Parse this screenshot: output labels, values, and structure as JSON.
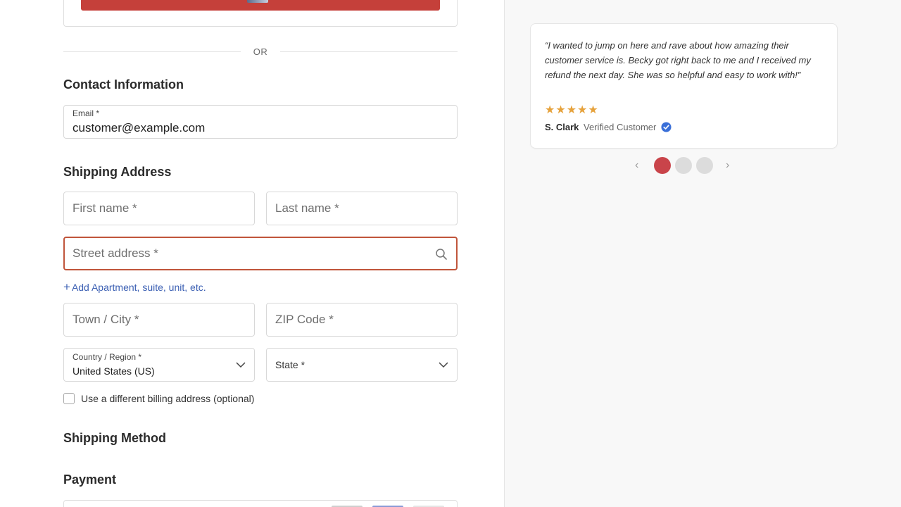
{
  "express": {
    "divider_text": "OR"
  },
  "contact": {
    "title": "Contact Information",
    "email_label": "Email *",
    "email_value": "customer@example.com"
  },
  "shipping": {
    "title": "Shipping Address",
    "first_name_placeholder": "First name *",
    "last_name_placeholder": "Last name *",
    "street_placeholder": "Street address *",
    "add_apartment": "Add Apartment, suite, unit, etc.",
    "city_placeholder": "Town / City *",
    "zip_placeholder": "ZIP Code *",
    "country_label": "Country / Region *",
    "country_value": "United States (US)",
    "state_placeholder": "State *",
    "billing_checkbox_label": "Use a different billing address (optional)"
  },
  "shipping_method": {
    "title": "Shipping Method"
  },
  "payment": {
    "title": "Payment"
  },
  "review": {
    "quote": "“I wanted to jump on here and rave about how amazing their customer service is. Becky got right back to me and I received my refund the next day. She was so helpful and easy to work with!”",
    "stars": "★★★★★",
    "rating": 5,
    "author": "S. Clark",
    "verified": "Verified Customer"
  },
  "carousel": {
    "prev": "‹",
    "next": "›",
    "slides": 3,
    "active": 1
  },
  "colors": {
    "accent_red": "#c5403a",
    "focus_border": "#c0553b",
    "link_blue": "#3b5fb3",
    "star": "#e6a23c",
    "verified_blue": "#3a6fd8"
  }
}
